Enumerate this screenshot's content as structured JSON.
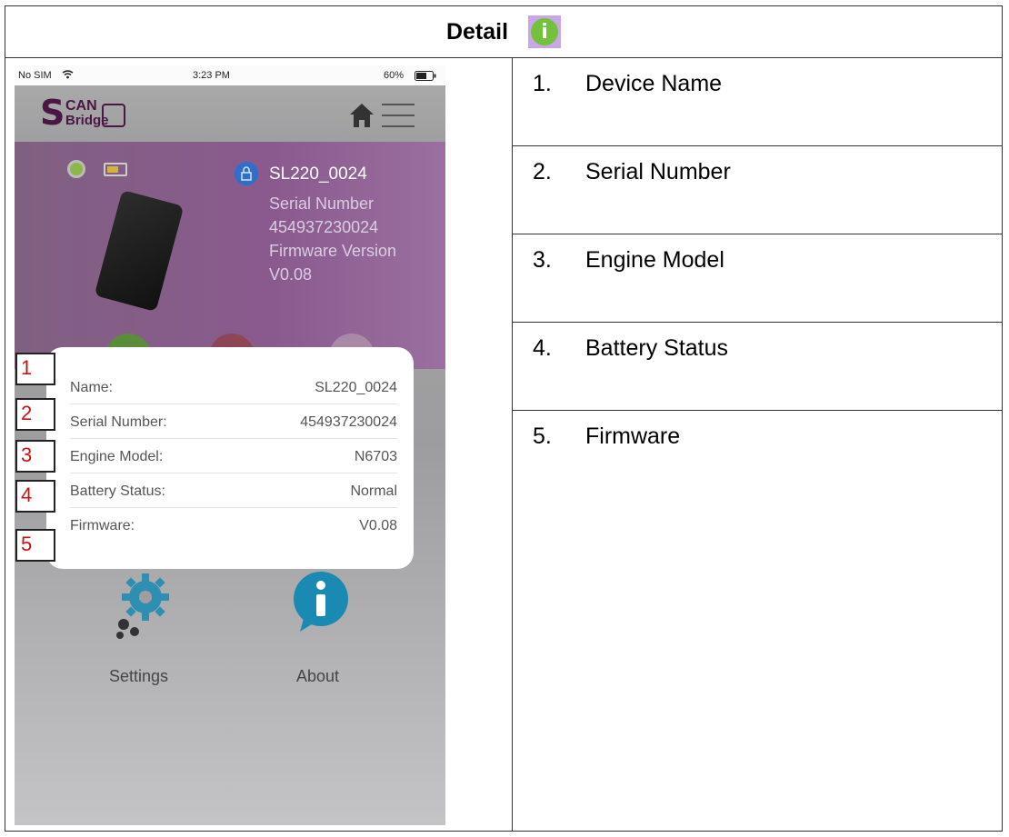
{
  "header": {
    "title": "Detail",
    "icon": "info-icon",
    "icon_glyph": "i",
    "icon_color": "#73c23c"
  },
  "details_list": [
    {
      "num": "1.",
      "label": "Device Name"
    },
    {
      "num": "2.",
      "label": "Serial Number"
    },
    {
      "num": "3.",
      "label": "Engine Model"
    },
    {
      "num": "4.",
      "label": "Battery Status"
    },
    {
      "num": "5.",
      "label": "Firmware"
    }
  ],
  "phone": {
    "status": {
      "carrier": "No SIM",
      "time": "3:23 PM",
      "battery": "60%"
    },
    "logo": {
      "s": "S",
      "can": "CAN",
      "bridge": "Bridge"
    },
    "device": {
      "name": "SL220_0024",
      "serial_label": "Serial Number",
      "serial": "454937230024",
      "firmware_label": "Firmware Version",
      "firmware": "V0.08"
    },
    "card_rows": [
      {
        "key": "Name:",
        "value": "SL220_0024",
        "marker": "1"
      },
      {
        "key": "Serial Number:",
        "value": "454937230024",
        "marker": "2"
      },
      {
        "key": "Engine Model:",
        "value": "N6703",
        "marker": "3"
      },
      {
        "key": "Battery Status:",
        "value": "Normal",
        "marker": "4"
      },
      {
        "key": "Firmware:",
        "value": "V0.08",
        "marker": "5"
      }
    ],
    "tiles": {
      "settings": "Settings",
      "about": "About"
    }
  }
}
